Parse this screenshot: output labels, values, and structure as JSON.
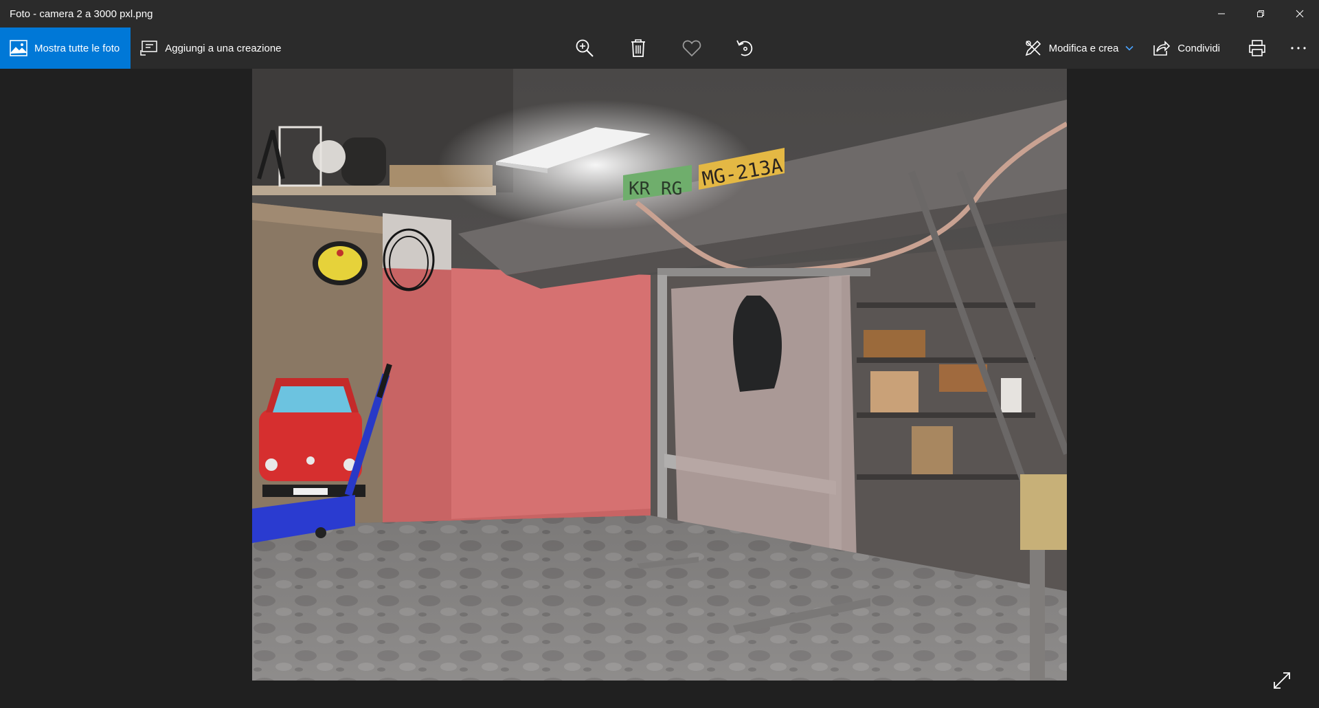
{
  "window": {
    "title": "Foto - camera 2 a 3000 pxl.png"
  },
  "toolbar": {
    "show_all_photos": "Mostra tutte le foto",
    "add_to_creation": "Aggiungi a una creazione",
    "edit_create": "Modifica e crea",
    "share": "Condividi"
  },
  "photo": {
    "plate_left": "KR RG",
    "plate_right": "MG-213A"
  },
  "colors": {
    "accent": "#0078d7",
    "titlebar": "#2b2b2b",
    "background": "#202020"
  },
  "icons": [
    "photos-app-icon",
    "add-creation-icon",
    "zoom-in-icon",
    "delete-icon",
    "heart-icon",
    "rotate-icon",
    "edit-create-icon",
    "chevron-down-icon",
    "share-icon",
    "print-icon",
    "more-icon",
    "expand-icon",
    "minimize-icon",
    "restore-icon",
    "close-icon"
  ]
}
